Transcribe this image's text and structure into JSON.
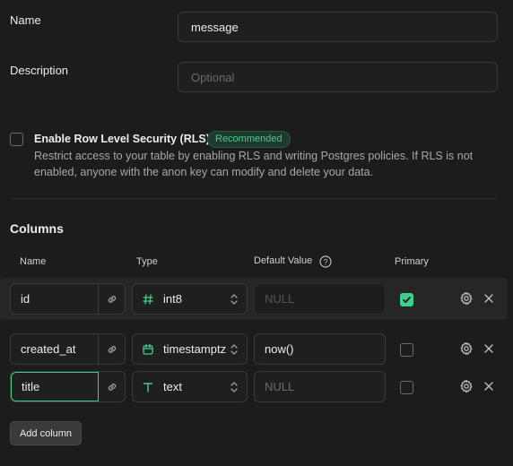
{
  "form": {
    "name_label": "Name",
    "name_value": "message",
    "description_label": "Description",
    "description_placeholder": "Optional"
  },
  "rls": {
    "title": "Enable Row Level Security (RLS)",
    "badge": "Recommended",
    "description": "Restrict access to your table by enabling RLS and writing Postgres policies. If RLS is not enabled, anyone with the anon key can modify and delete your data.",
    "checked": false
  },
  "columns": {
    "heading": "Columns",
    "headers": {
      "name": "Name",
      "type": "Type",
      "default_value": "Default Value",
      "primary": "Primary"
    },
    "rows": [
      {
        "name": "id",
        "type": "int8",
        "type_icon": "hash-icon",
        "default": "NULL",
        "default_is_placeholder": true,
        "primary": true
      },
      {
        "name": "created_at",
        "type": "timestamptz",
        "type_icon": "calendar-icon",
        "default": "now()",
        "default_is_placeholder": false,
        "primary": false
      },
      {
        "name": "title",
        "type": "text",
        "type_icon": "text-type-icon",
        "default": "NULL",
        "default_is_placeholder": true,
        "primary": false
      }
    ],
    "add_button": "Add column"
  },
  "colors": {
    "accent": "#3ecf8e",
    "background": "#1c1c1c"
  }
}
